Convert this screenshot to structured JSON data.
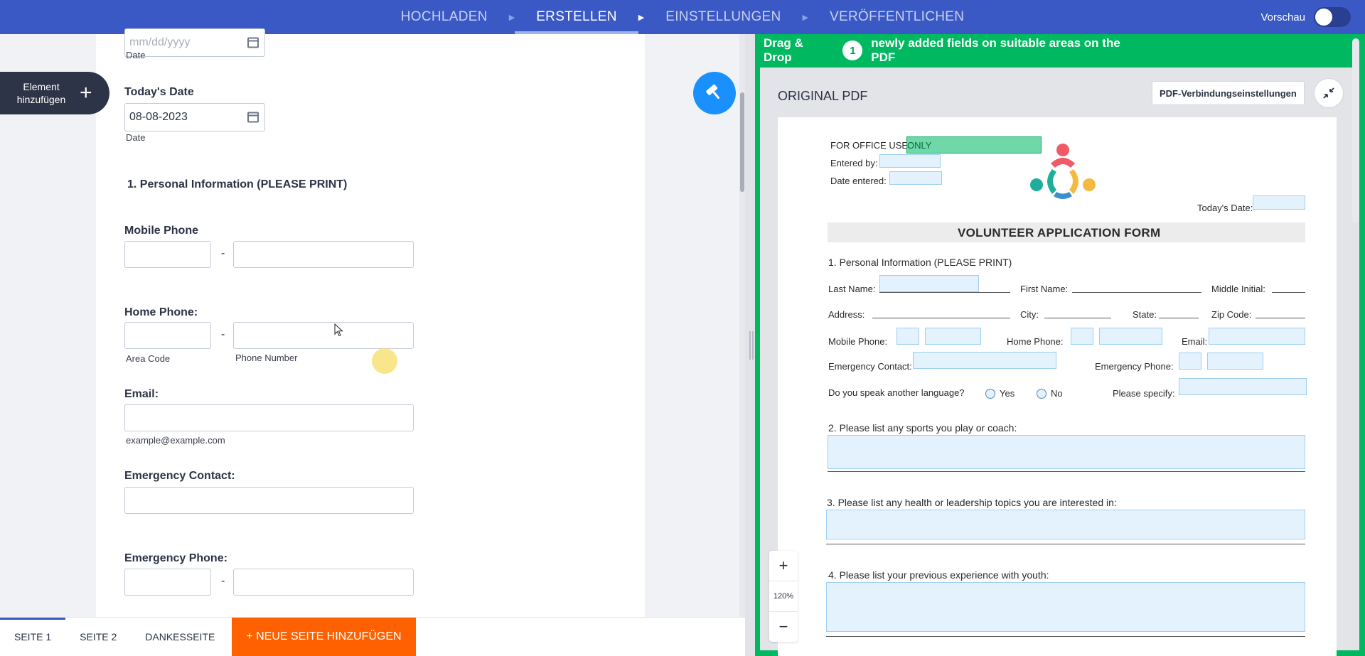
{
  "topnav": {
    "steps": [
      {
        "label": "HOCHLADEN"
      },
      {
        "label": "ERSTELLEN"
      },
      {
        "label": "EINSTELLUNGEN"
      },
      {
        "label": "VERÖFFENTLICHEN"
      }
    ],
    "active_step": "ERSTELLEN",
    "preview_label": "Vorschau",
    "preview_on": false
  },
  "left": {
    "add_element_label": "Element hinzufügen",
    "fields": {
      "date_top": {
        "placeholder": "mm/dd/yyyy",
        "sublabel": "Date"
      },
      "todays_date": {
        "label": "Today's Date",
        "value": "08-08-2023",
        "sublabel": "Date"
      },
      "section_title": "1. Personal Information (PLEASE PRINT)",
      "mobile_phone": {
        "label": "Mobile Phone",
        "dash": "-"
      },
      "home_phone": {
        "label": "Home Phone:",
        "dash": "-",
        "area_sublabel": "Area Code",
        "number_sublabel": "Phone Number"
      },
      "email": {
        "label": "Email:",
        "sublabel": "example@example.com"
      },
      "emergency_contact": {
        "label": "Emergency Contact:"
      },
      "emergency_phone": {
        "label": "Emergency Phone:",
        "dash": "-"
      }
    }
  },
  "bottom_tabs": {
    "tabs": [
      "SEITE 1",
      "SEITE 2",
      "DANKESSEITE"
    ],
    "active": "SEITE 1",
    "new_page_label": "+ NEUE SEITE HINZUFÜGEN"
  },
  "pdf_panel": {
    "banner": {
      "prefix": "Drag & Drop",
      "count": "1",
      "suffix": "newly added fields on suitable areas on the PDF"
    },
    "original_label": "ORIGINAL PDF",
    "connection_button": "PDF-Verbindungseinstellungen",
    "zoom_level": "120%",
    "zoom_in": "+",
    "zoom_out": "−",
    "document": {
      "office_use": "FOR OFFICE USE",
      "office_only": "ONLY",
      "entered_by": "Entered by:",
      "date_entered": "Date entered:",
      "todays_date": "Today's Date:",
      "title": "VOLUNTEER APPLICATION FORM",
      "section1": "1. Personal Information (PLEASE PRINT)",
      "last_name": "Last Name:",
      "first_name": "First Name:",
      "middle_initial": "Middle Initial:",
      "address": "Address:",
      "city": "City:",
      "state": "State:",
      "zip": "Zip Code:",
      "mobile_phone": "Mobile Phone:",
      "home_phone": "Home Phone:",
      "email": "Email:",
      "emergency_contact": "Emergency Contact:",
      "emergency_phone": "Emergency Phone:",
      "language_q": "Do you speak another language?",
      "yes": "Yes",
      "no": "No",
      "please_specify": "Please specify:",
      "q2": "2. Please list any sports you play or coach:",
      "q3": "3. Please list any health or leadership topics you are interested in:",
      "q4": "4. Please list your previous experience with youth:"
    }
  },
  "colors": {
    "nav": "#3a59c4",
    "accent_orange": "#ff6100",
    "pdf_green": "#00b860",
    "fab_blue": "#1a90ff"
  }
}
